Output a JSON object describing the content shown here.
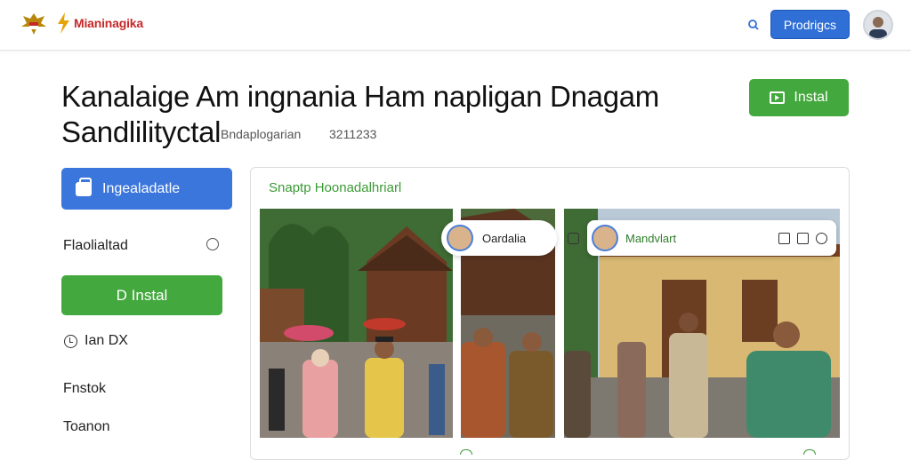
{
  "header": {
    "brand_name": "Mianinagika",
    "primary_button_label": "Prodrigcs",
    "brand_color": "#c62828",
    "accent_color": "#2f6fd6"
  },
  "page": {
    "title_line1": "Kanalaige Am ingnania Ham napligan Dnagam",
    "title_line2": "Sandlilityctal",
    "meta_label": "Bndaplogarian",
    "meta_value": "3211233",
    "install_top_label": "Instal"
  },
  "sidebar": {
    "blue_button_label": "Ingealadatle",
    "row1_label": "Flaolialtad",
    "green_button_label": "D Instal",
    "time_label": "Ian DX",
    "row3_label": "Fnstok",
    "row4_label": "Toanon",
    "green_color": "#43a83d"
  },
  "gallery": {
    "title": "Snaptp Hoonadalhriarl",
    "bubble1_label": "Oardalia",
    "bubble2_label": "Mandvlart"
  }
}
